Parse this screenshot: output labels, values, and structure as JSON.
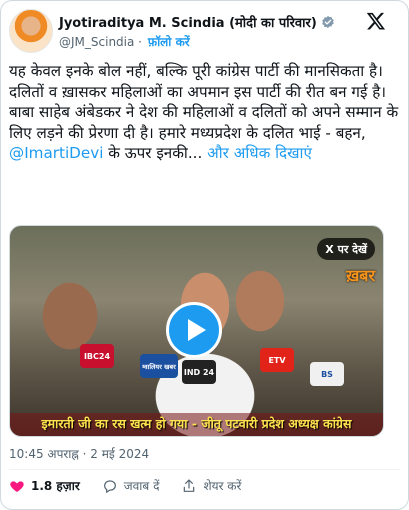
{
  "author": {
    "name": "Jyotiraditya M. Scindia (मोदी का परिवार)",
    "handle": "@JM_Scindia",
    "follow_label": "फ़ॉलो करें"
  },
  "tweet": {
    "text_part1": "यह केवल इनके बोल नहीं, बल्कि पूरी कांग्रेस पार्टी की मानसिकता है। दलितों व ख़ासकर महिलाओं का अपमान इस पार्टी की रीत बन गई है। बाबा साहेब अंबेडकर ने देश की महिलाओं व दलितों को अपने सम्मान के लिए लड़ने की प्रेरणा दी है। हमारे मध्यप्रदेश के दलित भाई - बहन, ",
    "mention": "@ImartiDevi",
    "text_part2": " के ऊपर इनकी... ",
    "show_more": "और अधिक दिखाएं"
  },
  "video": {
    "watch_on_x": "X पर देखें",
    "channel_logo": "ख़बर",
    "caption": "इमारती जी का रस खत्म हो गया - जीतू पटवारी प्रदेश अध्यक्ष कांग्रेस",
    "mic_labels": [
      "IBC24",
      "ग्वालियर खबर",
      "IND 24",
      "ETV",
      "BS"
    ]
  },
  "meta": {
    "timestamp": "10:45 अपराह्न · 2 मई 2024"
  },
  "actions": {
    "likes": "1.8 हज़ार",
    "reply_label": "जवाब दें",
    "share_label": "शेयर करें"
  },
  "colors": {
    "accent": "#1d9bf0",
    "like_red": "#f91880",
    "text": "#0f1419",
    "muted": "#536471"
  }
}
